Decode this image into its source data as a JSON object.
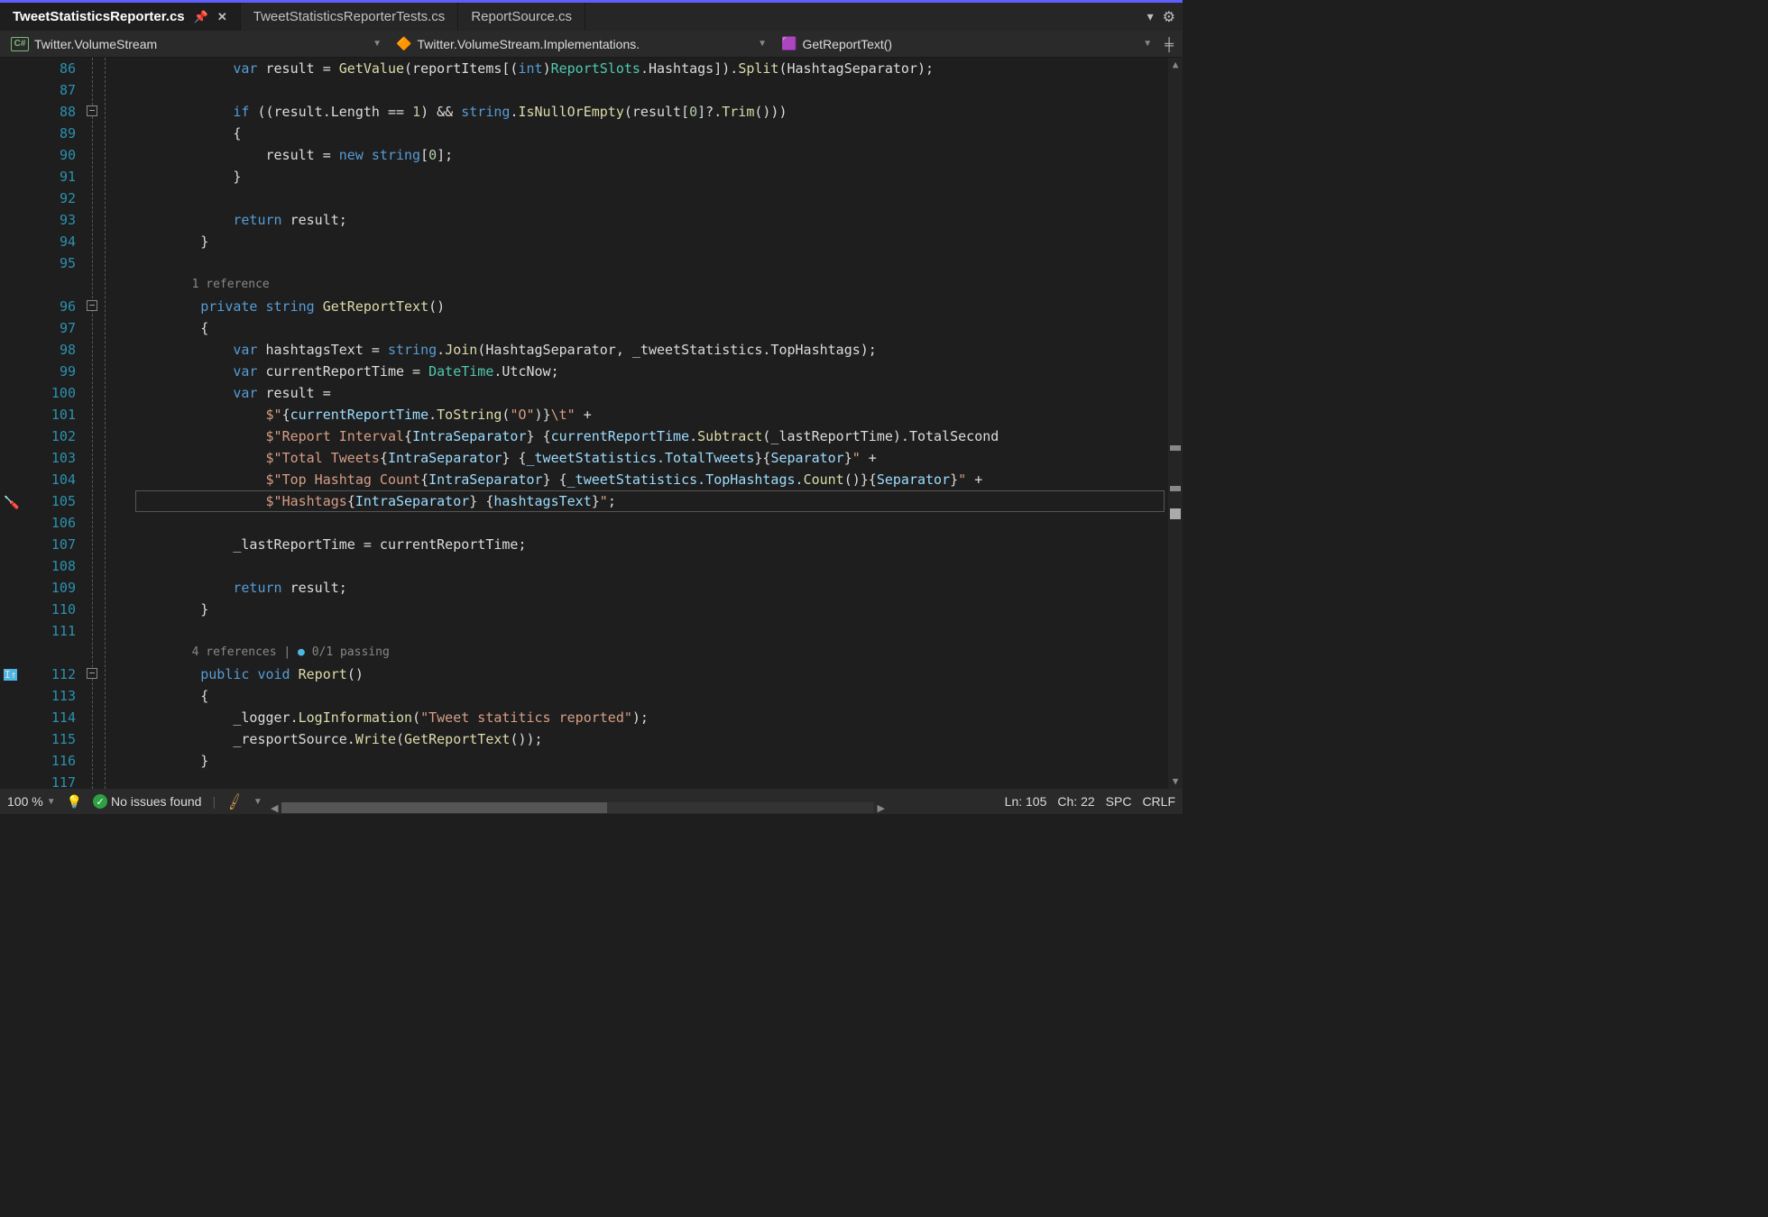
{
  "tabs": {
    "active": "TweetStatisticsReporter.cs",
    "t1": "TweetStatisticsReporterTests.cs",
    "t2": "ReportSource.cs"
  },
  "nav": {
    "namespace": "Twitter.VolumeStream",
    "class": "Twitter.VolumeStream.Implementations.",
    "method": "GetReportText()"
  },
  "codelens": {
    "ref1": "1 reference",
    "ref2a": "4 references",
    "ref2b": "0/1 passing"
  },
  "code": {
    "l86_a": "var",
    "l86_b": " result = ",
    "l86_c": "GetValue",
    "l86_d": "(reportItems[(",
    "l86_e": "int",
    "l86_f": ")",
    "l86_g": "ReportSlots",
    "l86_h": ".Hashtags]).",
    "l86_i": "Split",
    "l86_j": "(HashtagSeparator);",
    "l88_a": "if",
    "l88_b": " ((result.Length == ",
    "l88_c": "1",
    "l88_d": ") && ",
    "l88_e": "string",
    "l88_f": ".",
    "l88_g": "IsNullOrEmpty",
    "l88_h": "(result[",
    "l88_i": "0",
    "l88_j": "]?.",
    "l88_k": "Trim",
    "l88_l": "()))",
    "l89": "{",
    "l90_a": "result = ",
    "l90_b": "new",
    "l90_c": " ",
    "l90_d": "string",
    "l90_e": "[",
    "l90_f": "0",
    "l90_g": "];",
    "l91": "}",
    "l93_a": "return",
    "l93_b": " result;",
    "l94": "}",
    "l96_a": "private",
    "l96_b": " ",
    "l96_c": "string",
    "l96_d": " ",
    "l96_e": "GetReportText",
    "l96_f": "()",
    "l97": "{",
    "l98_a": "var",
    "l98_b": " hashtagsText = ",
    "l98_c": "string",
    "l98_d": ".",
    "l98_e": "Join",
    "l98_f": "(HashtagSeparator, _tweetStatistics.TopHashtags);",
    "l99_a": "var",
    "l99_b": " currentReportTime = ",
    "l99_c": "DateTime",
    "l99_d": ".UtcNow;",
    "l100_a": "var",
    "l100_b": " result =",
    "l101_a": "$\"",
    "l101_b": "{",
    "l101_c": "currentReportTime",
    "l101_d": ".",
    "l101_e": "ToString",
    "l101_f": "(",
    "l101_g": "\"O\"",
    "l101_h": ")",
    "l101_i": "}",
    "l101_j": "\\t\"",
    "l101_k": " +",
    "l102_a": "$\"",
    "l102_b": "Report Interval",
    "l102_c": "{",
    "l102_d": "IntraSeparator",
    "l102_e": "}",
    "l102_f": " ",
    "l102_g": "{",
    "l102_h": "currentReportTime",
    "l102_i": ".",
    "l102_j": "Subtract",
    "l102_k": "(_lastReportTime).TotalSecond",
    "l103_a": "$\"",
    "l103_b": "Total Tweets",
    "l103_c": "{",
    "l103_d": "IntraSeparator",
    "l103_e": "}",
    "l103_f": " ",
    "l103_g": "{",
    "l103_h": "_tweetStatistics.TotalTweets",
    "l103_i": "}{",
    "l103_j": "Separator",
    "l103_k": "}",
    "l103_l": "\"",
    "l103_m": " +",
    "l104_a": "$\"",
    "l104_b": "Top Hashtag Count",
    "l104_c": "{",
    "l104_d": "IntraSeparator",
    "l104_e": "}",
    "l104_f": " ",
    "l104_g": "{",
    "l104_h": "_tweetStatistics.TopHashtags.",
    "l104_i": "Count",
    "l104_j": "()",
    "l104_k": "}{",
    "l104_l": "Separator",
    "l104_m": "}",
    "l104_n": "\"",
    "l104_o": " +",
    "l105_a": "$\"",
    "l105_b": "Hashtags",
    "l105_c": "{",
    "l105_d": "IntraSeparator",
    "l105_e": "}",
    "l105_f": " ",
    "l105_g": "{",
    "l105_h": "hashtagsText",
    "l105_i": "}",
    "l105_j": "\"",
    "l105_k": ";",
    "l107": "_lastReportTime = currentReportTime;",
    "l109_a": "return",
    "l109_b": " result;",
    "l110": "}",
    "l112_a": "public",
    "l112_b": " ",
    "l112_c": "void",
    "l112_d": " ",
    "l112_e": "Report",
    "l112_f": "()",
    "l113": "{",
    "l114_a": "_logger.",
    "l114_b": "LogInformation",
    "l114_c": "(",
    "l114_d": "\"Tweet statitics reported\"",
    "l114_e": ");",
    "l115_a": "_resportSource.",
    "l115_b": "Write",
    "l115_c": "(",
    "l115_d": "GetReportText",
    "l115_e": "());",
    "l116": "}"
  },
  "lines": [
    "86",
    "87",
    "88",
    "89",
    "90",
    "91",
    "92",
    "93",
    "94",
    "95",
    "",
    "96",
    "97",
    "98",
    "99",
    "100",
    "101",
    "102",
    "103",
    "104",
    "105",
    "106",
    "107",
    "108",
    "109",
    "110",
    "111",
    "",
    "112",
    "113",
    "114",
    "115",
    "116",
    "117"
  ],
  "status": {
    "zoom": "100 %",
    "issues": "No issues found",
    "ln": "Ln: 105",
    "ch": "Ch: 22",
    "spc": "SPC",
    "crlf": "CRLF"
  }
}
